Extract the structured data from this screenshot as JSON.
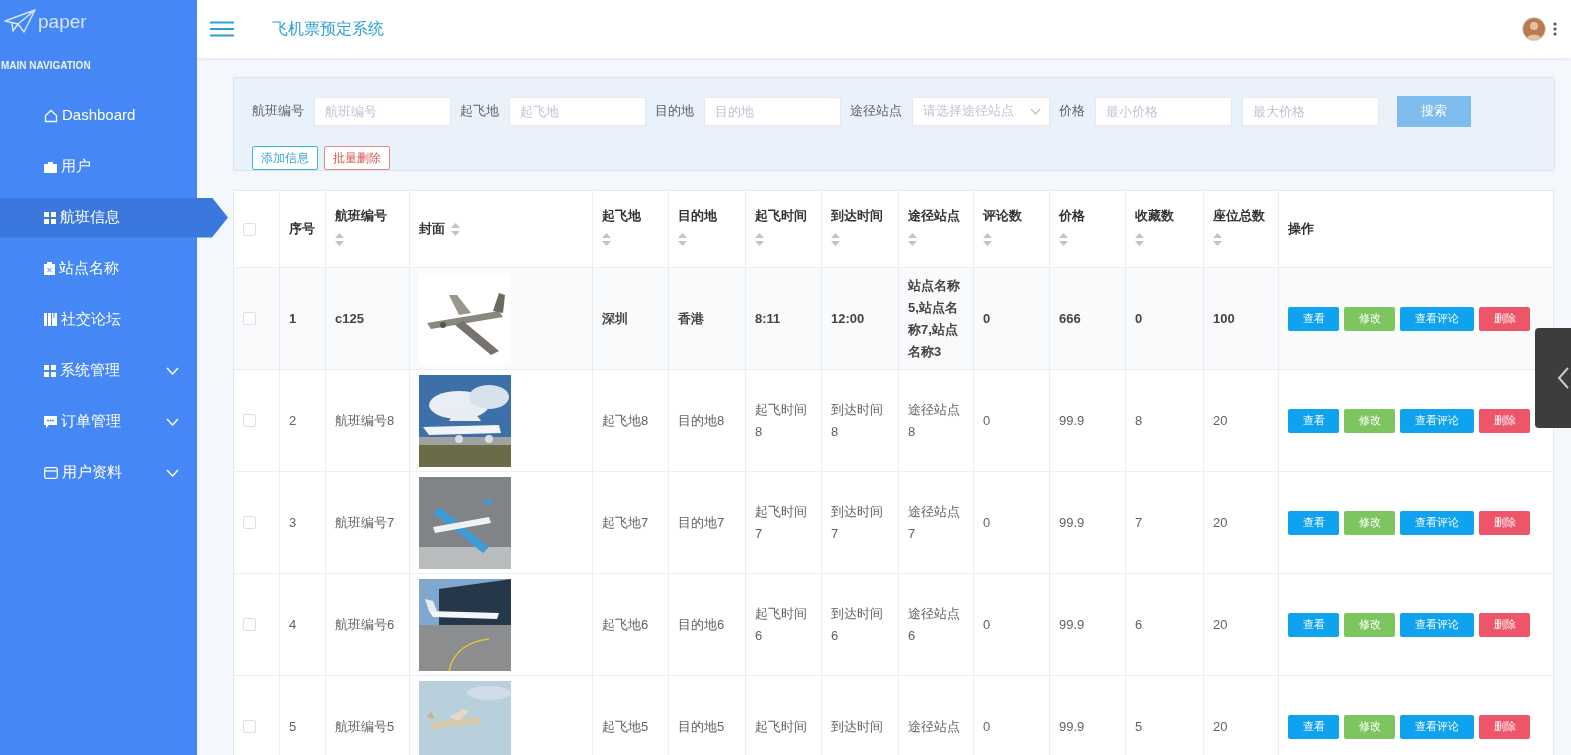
{
  "brand": {
    "name": "paper"
  },
  "sidebar": {
    "heading": "MAIN NAVIGATION",
    "items": [
      {
        "label": "Dashboard",
        "kind": "link",
        "selected": false
      },
      {
        "label": "用户",
        "kind": "link",
        "selected": false
      },
      {
        "label": "航班信息",
        "kind": "link",
        "selected": true
      },
      {
        "label": "站点名称",
        "kind": "link",
        "selected": false
      },
      {
        "label": "社交论坛",
        "kind": "link",
        "selected": false
      },
      {
        "label": "系统管理",
        "kind": "submenu",
        "selected": false,
        "expanded": false
      },
      {
        "label": "订单管理",
        "kind": "submenu",
        "selected": false,
        "expanded": false
      },
      {
        "label": "用户资料",
        "kind": "submenu",
        "selected": false,
        "expanded": false
      }
    ]
  },
  "header": {
    "title": "飞机票预定系统"
  },
  "search": {
    "fields": [
      {
        "kind": "input",
        "label": "航班编号",
        "placeholder": "航班编号"
      },
      {
        "kind": "input",
        "label": "起飞地",
        "placeholder": "起飞地"
      },
      {
        "kind": "input",
        "label": "目的地",
        "placeholder": "目的地"
      },
      {
        "kind": "select",
        "label": "途径站点",
        "placeholder": "请选择途径站点"
      },
      {
        "kind": "range",
        "label": "价格",
        "placeholder": "最小价格",
        "placeholder_max": "最大价格"
      }
    ],
    "search_button": "搜索",
    "add_button": "添加信息",
    "batch_delete_button": "批量删除"
  },
  "table": {
    "columns": [
      {
        "label": "序号",
        "sortable": false
      },
      {
        "label": "航班编号",
        "sortable": true
      },
      {
        "label": "封面",
        "sortable": true
      },
      {
        "label": "起飞地",
        "sortable": true
      },
      {
        "label": "目的地",
        "sortable": true
      },
      {
        "label": "起飞时间",
        "sortable": true
      },
      {
        "label": "到达时间",
        "sortable": true
      },
      {
        "label": "途径站点",
        "sortable": true
      },
      {
        "label": "评论数",
        "sortable": true
      },
      {
        "label": "价格",
        "sortable": true
      },
      {
        "label": "收藏数",
        "sortable": true
      },
      {
        "label": "座位总数",
        "sortable": true
      },
      {
        "label": "操作",
        "sortable": false
      }
    ],
    "header_checked": false,
    "rows": [
      {
        "checked": false,
        "highlighted": true,
        "cells": [
          "1",
          "c125",
          "",
          "深圳",
          "香港",
          "8:11",
          "12:00",
          "站点名称5,站点名称7,站点名称3",
          "0",
          "666",
          "0",
          "100"
        ],
        "actions": [
          {
            "kind": "view",
            "label": "查看"
          },
          {
            "kind": "edit",
            "label": "修改"
          },
          {
            "kind": "view",
            "label": "查看评论"
          },
          {
            "kind": "delete",
            "label": "删除"
          }
        ]
      },
      {
        "checked": false,
        "highlighted": false,
        "cells": [
          "2",
          "航班编号8",
          "",
          "起飞地8",
          "目的地8",
          "起飞时间8",
          "到达时间8",
          "途径站点8",
          "0",
          "99.9",
          "8",
          "20"
        ],
        "actions": [
          {
            "kind": "view",
            "label": "查看"
          },
          {
            "kind": "edit",
            "label": "修改"
          },
          {
            "kind": "view",
            "label": "查看评论"
          },
          {
            "kind": "delete",
            "label": "删除"
          }
        ]
      },
      {
        "checked": false,
        "highlighted": false,
        "cells": [
          "3",
          "航班编号7",
          "",
          "起飞地7",
          "目的地7",
          "起飞时间7",
          "到达时间7",
          "途径站点7",
          "0",
          "99.9",
          "7",
          "20"
        ],
        "actions": [
          {
            "kind": "view",
            "label": "查看"
          },
          {
            "kind": "edit",
            "label": "修改"
          },
          {
            "kind": "view",
            "label": "查看评论"
          },
          {
            "kind": "delete",
            "label": "删除"
          }
        ]
      },
      {
        "checked": false,
        "highlighted": false,
        "cells": [
          "4",
          "航班编号6",
          "",
          "起飞地6",
          "目的地6",
          "起飞时间6",
          "到达时间6",
          "途径站点6",
          "0",
          "99.9",
          "6",
          "20"
        ],
        "actions": [
          {
            "kind": "view",
            "label": "查看"
          },
          {
            "kind": "edit",
            "label": "修改"
          },
          {
            "kind": "view",
            "label": "查看评论"
          },
          {
            "kind": "delete",
            "label": "删除"
          }
        ]
      },
      {
        "checked": false,
        "highlighted": false,
        "cells": [
          "5",
          "航班编号5",
          "",
          "起飞地5",
          "目的地5",
          "起飞时间",
          "到达时间",
          "途径站点",
          "0",
          "99.9",
          "5",
          "20"
        ],
        "actions": [
          {
            "kind": "view",
            "label": "查看"
          },
          {
            "kind": "edit",
            "label": "修改"
          },
          {
            "kind": "view",
            "label": "查看评论"
          },
          {
            "kind": "delete",
            "label": "删除"
          }
        ]
      }
    ]
  }
}
